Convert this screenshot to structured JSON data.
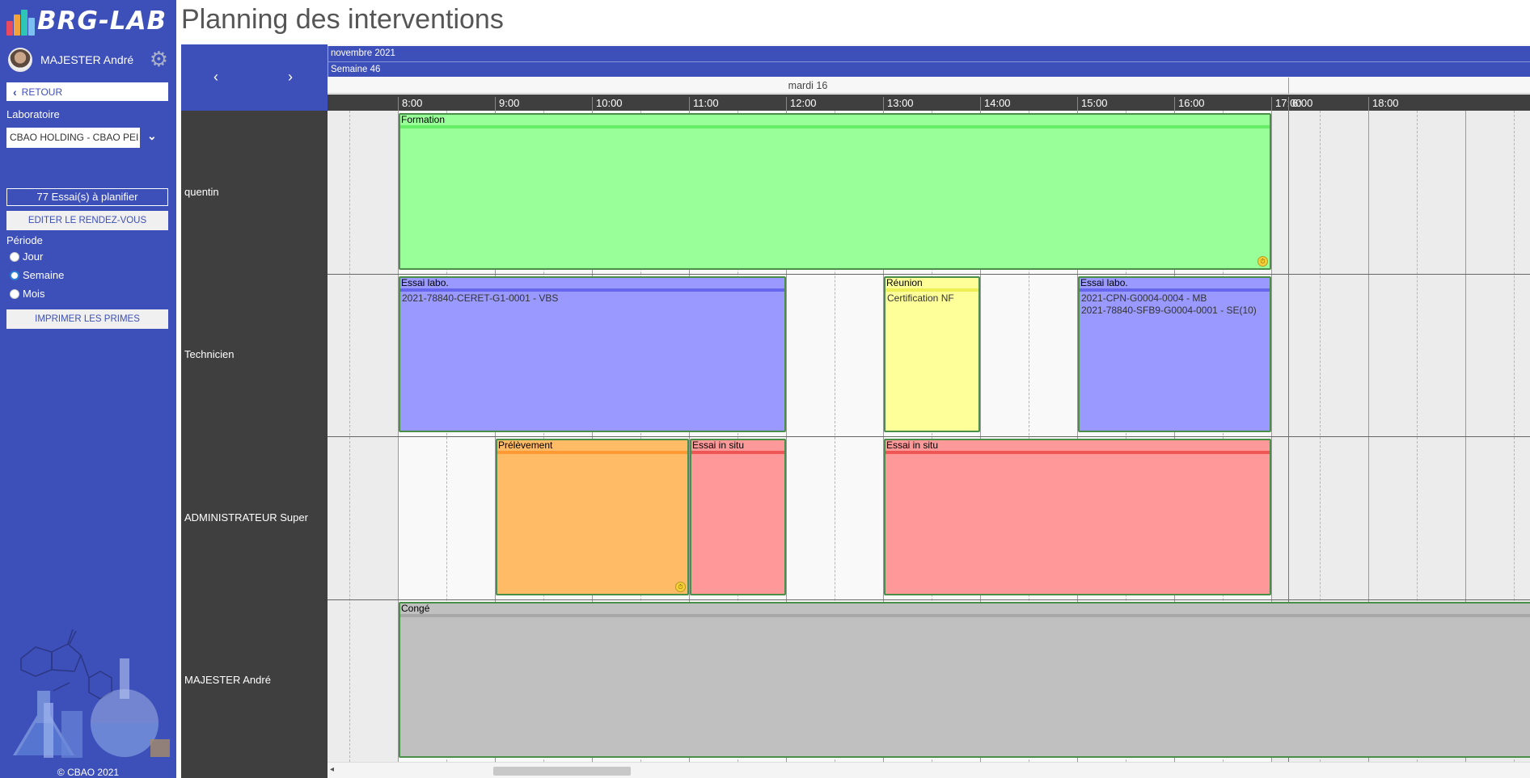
{
  "app": {
    "logo_text": "BRG-LAB",
    "page_title": "Planning des interventions",
    "copyright": "© CBAO 2021"
  },
  "user": {
    "name": "MAJESTER André",
    "avatar_icon": "user-avatar",
    "settings_icon": "gear-icon"
  },
  "sidebar": {
    "back_label": "RETOUR",
    "lab_label": "Laboratoire",
    "lab_value": "CBAO HOLDING - CBAO PEI",
    "essais_label": "77 Essai(s) à planifier",
    "edit_label": "EDITER LE RENDEZ-VOUS",
    "period_label": "Période",
    "period_options": [
      "Jour",
      "Semaine",
      "Mois"
    ],
    "period_selected": "Semaine",
    "print_label": "IMPRIMER LES PRIMES"
  },
  "schedule": {
    "month": "novembre 2021",
    "week": "Semaine 46",
    "day": "mardi 16",
    "hours": [
      "8:00",
      "9:00",
      "10:00",
      "11:00",
      "12:00",
      "13:00",
      "14:00",
      "15:00",
      "16:00",
      "17:00",
      "18:00",
      "6:00"
    ],
    "nav_prev": "‹",
    "nav_next": "›",
    "resources": [
      "quentin",
      "Technicien",
      "ADMINISTRATEUR Super",
      "MAJESTER André"
    ],
    "events": [
      {
        "resource": 0,
        "start": 8.0,
        "end": 17.0,
        "title": "Formation",
        "text": "",
        "color": "#99ff99",
        "bar": "#66ee66",
        "icon": true
      },
      {
        "resource": 1,
        "start": 8.0,
        "end": 12.0,
        "title": "Essai labo.",
        "text": "2021-78840-CERET-G1-0001 - VBS",
        "color": "#9999ff",
        "bar": "#6666ee",
        "icon": false
      },
      {
        "resource": 1,
        "start": 13.0,
        "end": 14.0,
        "title": "Réunion",
        "text": "Certification NF",
        "color": "#ffff99",
        "bar": "#eeee55",
        "icon": false
      },
      {
        "resource": 1,
        "start": 15.0,
        "end": 17.0,
        "title": "Essai labo.",
        "text": "2021-CPN-G0004-0004 - MB\n2021-78840-SFB9-G0004-0001 - SE(10)",
        "color": "#9999ff",
        "bar": "#6666ee",
        "icon": false
      },
      {
        "resource": 2,
        "start": 9.0,
        "end": 11.0,
        "title": "Prélèvement",
        "text": "",
        "color": "#ffbb66",
        "bar": "#ff9933",
        "icon": true
      },
      {
        "resource": 2,
        "start": 11.0,
        "end": 12.0,
        "title": "Essai in situ",
        "text": "",
        "color": "#ff9999",
        "bar": "#ee5555",
        "icon": false
      },
      {
        "resource": 2,
        "start": 13.0,
        "end": 17.0,
        "title": "Essai in situ",
        "text": "",
        "color": "#ff9999",
        "bar": "#ee5555",
        "icon": false
      },
      {
        "resource": 3,
        "start": 8.0,
        "end": 21.0,
        "title": "Congé",
        "text": "",
        "color": "#c0c0c0",
        "bar": "#a8a8a8",
        "icon": false
      }
    ]
  }
}
